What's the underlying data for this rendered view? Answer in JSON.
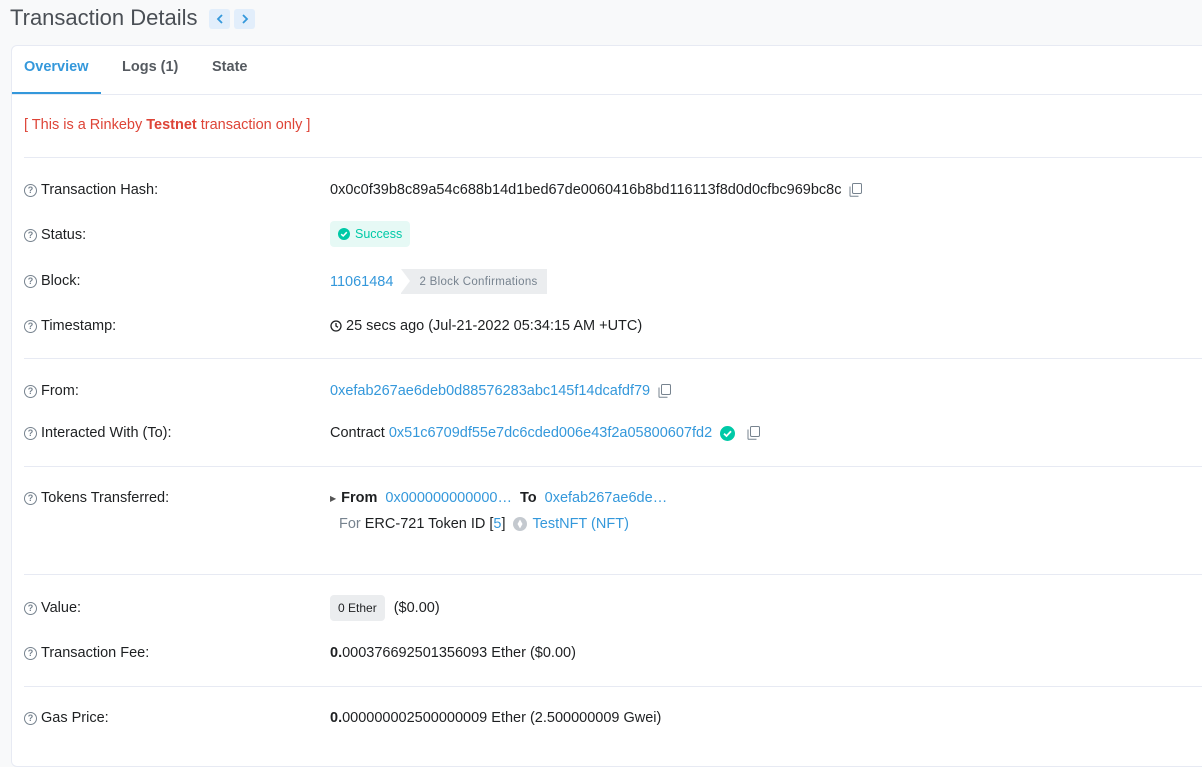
{
  "header": {
    "title": "Transaction Details",
    "prev_icon": "chevron-left-icon",
    "next_icon": "chevron-right-icon"
  },
  "tabs": [
    {
      "label": "Overview",
      "active": true
    },
    {
      "label": "Logs (1)",
      "active": false
    },
    {
      "label": "State",
      "active": false
    }
  ],
  "notice": {
    "prefix": "[ This is a Rinkeby ",
    "bold": "Testnet",
    "suffix": " transaction only ]"
  },
  "rows": {
    "tx_hash": {
      "label": "Transaction Hash:",
      "value": "0x0c0f39b8c89a54c688b14d1bed67de0060416b8bd116113f8d0d0cfbc969bc8c"
    },
    "status": {
      "label": "Status:",
      "value": "Success"
    },
    "block": {
      "label": "Block:",
      "number": "11061484",
      "confirmations": "2 Block Confirmations"
    },
    "timestamp": {
      "label": "Timestamp:",
      "value": "25 secs ago (Jul-21-2022 05:34:15 AM +UTC)"
    },
    "from": {
      "label": "From:",
      "value": "0xefab267ae6deb0d88576283abc145f14dcafdf79"
    },
    "to": {
      "label": "Interacted With (To):",
      "prefix": "Contract",
      "value": "0x51c6709df55e7dc6cded006e43f2a05800607fd2"
    },
    "tokens": {
      "label": "Tokens Transferred:",
      "from_label": "From",
      "from_value": "0x000000000000…",
      "to_label": "To",
      "to_value": "0xefab267ae6de…",
      "for_label": "For",
      "token_type": "ERC-721 Token ID",
      "bracket_open": "[",
      "token_id": "5",
      "bracket_close": "]",
      "token_name": "TestNFT (NFT)"
    },
    "value": {
      "label": "Value:",
      "badge": "0 Ether",
      "usd": "($0.00)"
    },
    "fee": {
      "label": "Transaction Fee:",
      "bold": "0.",
      "value": "000376692501356093 Ether ($0.00)"
    },
    "gas": {
      "label": "Gas Price:",
      "bold": "0.",
      "value": "000000002500000009 Ether (2.500000009 Gwei)"
    }
  },
  "colors": {
    "accent": "#3498db",
    "success": "#00c9a7",
    "danger": "#de4437"
  }
}
